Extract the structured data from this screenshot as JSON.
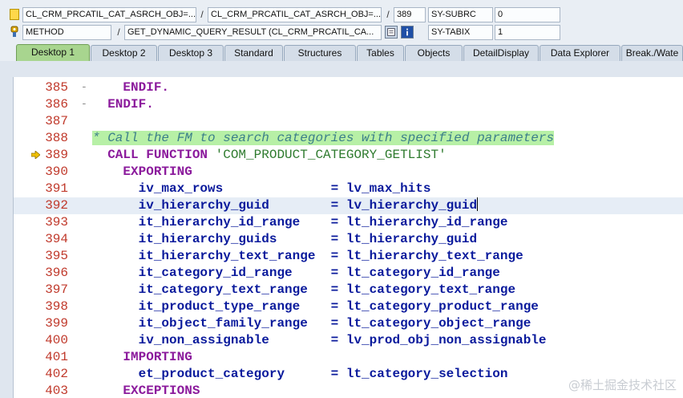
{
  "info": {
    "row1": {
      "field_a": "CL_CRM_PRCATIL_CAT_ASRCH_OBJ=...",
      "field_b": "CL_CRM_PRCATIL_CAT_ASRCH_OBJ=...",
      "line_no": "389",
      "var_name": "SY-SUBRC",
      "var_value": "0"
    },
    "row2": {
      "type": "METHOD",
      "name": "GET_DYNAMIC_QUERY_RESULT (CL_CRM_PRCATIL_CA...",
      "var_name": "SY-TABIX",
      "var_value": "1"
    },
    "separator": "/"
  },
  "tabs": [
    {
      "label": "Desktop 1",
      "active": true
    },
    {
      "label": "Desktop 2"
    },
    {
      "label": "Desktop 3"
    },
    {
      "label": "Standard"
    },
    {
      "label": "Structures"
    },
    {
      "label": "Tables"
    },
    {
      "label": "Objects"
    },
    {
      "label": "DetailDisplay"
    },
    {
      "label": "Data Explorer"
    },
    {
      "label": "Break./Wate"
    }
  ],
  "code": {
    "current_line": "389",
    "lines": [
      {
        "no": "385",
        "fold": "-",
        "indent": "    ",
        "parts": [
          {
            "t": "ENDIF.",
            "c": "kw"
          }
        ]
      },
      {
        "no": "386",
        "fold": "-",
        "indent": "  ",
        "parts": [
          {
            "t": "ENDIF.",
            "c": "kw"
          }
        ]
      },
      {
        "no": "387",
        "fold": "",
        "indent": "",
        "parts": []
      },
      {
        "no": "388",
        "fold": "",
        "indent": "",
        "parts": [
          {
            "t": "* Call the FM to search categories with specified parameters",
            "c": "cmt"
          }
        ]
      },
      {
        "no": "389",
        "fold": "",
        "indent": "  ",
        "parts": [
          {
            "t": "CALL FUNCTION ",
            "c": "kw"
          },
          {
            "t": "'COM_PRODUCT_CATEGORY_GETLIST'",
            "c": "str"
          }
        ]
      },
      {
        "no": "390",
        "fold": "",
        "indent": "    ",
        "parts": [
          {
            "t": "EXPORTING",
            "c": "kw"
          }
        ]
      },
      {
        "no": "391",
        "fold": "",
        "indent": "      ",
        "parts": [
          {
            "t": "iv_max_rows              = lv_max_hits",
            "c": "cn"
          }
        ]
      },
      {
        "no": "392",
        "fold": "",
        "indent": "      ",
        "parts": [
          {
            "t": "iv_hierarchy_guid        = lv_hierarchy_guid",
            "c": "cn"
          }
        ],
        "cursor": true
      },
      {
        "no": "393",
        "fold": "",
        "indent": "      ",
        "parts": [
          {
            "t": "it_hierarchy_id_range    = lt_hierarchy_id_range",
            "c": "cn"
          }
        ]
      },
      {
        "no": "394",
        "fold": "",
        "indent": "      ",
        "parts": [
          {
            "t": "it_hierarchy_guids       = lt_hierarchy_guid",
            "c": "cn"
          }
        ]
      },
      {
        "no": "395",
        "fold": "",
        "indent": "      ",
        "parts": [
          {
            "t": "it_hierarchy_text_range  = lt_hierarchy_text_range",
            "c": "cn"
          }
        ]
      },
      {
        "no": "396",
        "fold": "",
        "indent": "      ",
        "parts": [
          {
            "t": "it_category_id_range     = lt_category_id_range",
            "c": "cn"
          }
        ]
      },
      {
        "no": "397",
        "fold": "",
        "indent": "      ",
        "parts": [
          {
            "t": "it_category_text_range   = lt_category_text_range",
            "c": "cn"
          }
        ]
      },
      {
        "no": "398",
        "fold": "",
        "indent": "      ",
        "parts": [
          {
            "t": "it_product_type_range    = lt_category_product_range",
            "c": "cn"
          }
        ]
      },
      {
        "no": "399",
        "fold": "",
        "indent": "      ",
        "parts": [
          {
            "t": "it_object_family_range   = lt_category_object_range",
            "c": "cn"
          }
        ]
      },
      {
        "no": "400",
        "fold": "",
        "indent": "      ",
        "parts": [
          {
            "t": "iv_non_assignable        = lv_prod_obj_non_assignable",
            "c": "cn"
          }
        ]
      },
      {
        "no": "401",
        "fold": "",
        "indent": "    ",
        "parts": [
          {
            "t": "IMPORTING",
            "c": "kw"
          }
        ]
      },
      {
        "no": "402",
        "fold": "",
        "indent": "      ",
        "parts": [
          {
            "t": "et_product_category      = lt_category_selection",
            "c": "cn"
          }
        ]
      },
      {
        "no": "403",
        "fold": "",
        "indent": "    ",
        "parts": [
          {
            "t": "EXCEPTIONS",
            "c": "kw"
          }
        ]
      }
    ]
  },
  "watermark": "@稀土掘金技术社区",
  "colors": {
    "keyword": "#8b1a9c",
    "identifier": "#0a1a9c",
    "string": "#2f7b2f",
    "comment_bg": "#b7f0a6",
    "line_number": "#c0392b",
    "active_tab": "#a8d58f"
  }
}
